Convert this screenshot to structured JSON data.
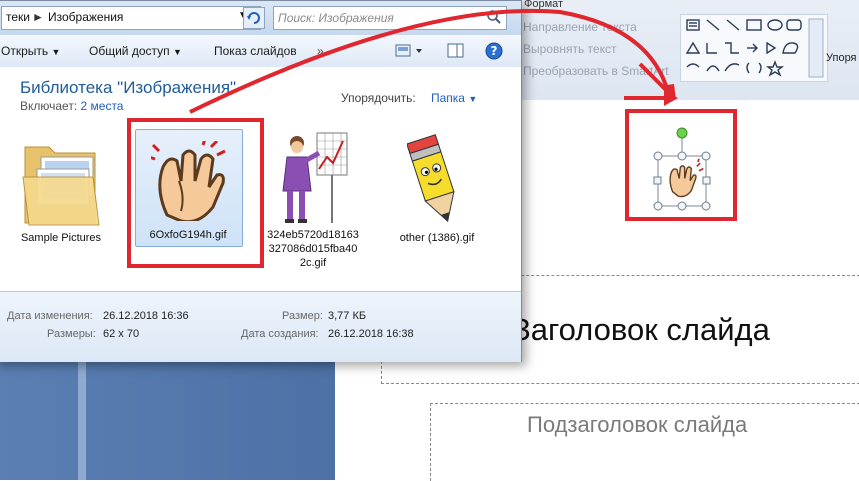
{
  "ppt": {
    "tab_format": "Формат",
    "cmd_text_direction": "Направление текста",
    "cmd_align_text": "Выровнять текст",
    "cmd_convert_smartart": "Преобразовать в SmartArt",
    "cmd_order": "Упоря",
    "slide_title": "Заголовок слайда",
    "slide_subtitle": "Подзаголовок слайда"
  },
  "explorer": {
    "breadcrumb_prev": "теки",
    "breadcrumb_current": "Изображения",
    "search_placeholder": "Поиск: Изображения",
    "toolbar": {
      "open": "Открыть",
      "share": "Общий доступ",
      "slideshow": "Показ слайдов"
    },
    "library": {
      "title": "Библиотека \"Изображения\"",
      "includes_label": "Включает:",
      "includes_value": "2 места",
      "arrange_label": "Упорядочить:",
      "arrange_value": "Папка"
    },
    "files": [
      {
        "name": "Sample Pictures",
        "icon": "folder-icon"
      },
      {
        "name": "6OxfoG194h.gif",
        "icon": "clapping-hands-image"
      },
      {
        "name": "324eb5720d18163327086d015fba402c.gif",
        "line1": "324eb5720d18163",
        "line2": "327086d015fba40",
        "line3": "2c.gif",
        "icon": "presenter-image"
      },
      {
        "name": "other (1386).gif",
        "icon": "pencil-character-image"
      }
    ],
    "details": {
      "modified_label": "Дата изменения:",
      "modified_value": "26.12.2018 16:36",
      "dims_label": "Размеры:",
      "dims_value": "62 x 70",
      "size_label": "Размер:",
      "size_value": "3,77 КБ",
      "created_label": "Дата создания:",
      "created_value": "26.12.2018 16:38"
    }
  },
  "colors": {
    "accent_red": "#e0262e",
    "link_blue": "#1f5fbf",
    "title_blue": "#1f5c99"
  }
}
